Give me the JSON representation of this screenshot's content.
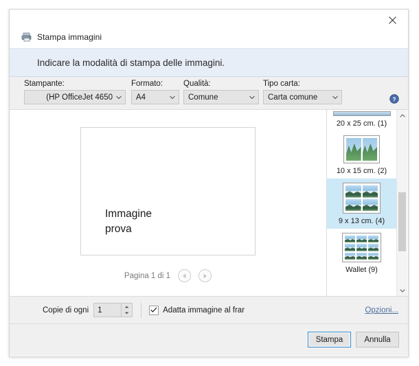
{
  "window": {
    "title": "Stampa immagini",
    "title_icon": "printer-icon",
    "close_icon": "close-icon",
    "banner_text": "Indicare la modalità di stampa delle immagini."
  },
  "options_bar": {
    "help_icon": "help-circle-icon",
    "fields": [
      {
        "key": "printer",
        "label": "Stampante:",
        "value": "(HP OfficeJet 4650",
        "align": "right"
      },
      {
        "key": "format",
        "label": "Formato:",
        "value": "A4",
        "align": "left"
      },
      {
        "key": "quality",
        "label": "Qualità:",
        "value": "Comune",
        "align": "left"
      },
      {
        "key": "papertype",
        "label": "Tipo carta:",
        "value": "Carta comune",
        "align": "left"
      }
    ]
  },
  "preview": {
    "caption_line1": "Immagine",
    "caption_line2": "prova",
    "pager_label": "Pagina 1 di 1",
    "prev_icon": "triangle-left-icon",
    "next_icon": "triangle-right-icon"
  },
  "layouts": {
    "scroll_up_icon": "chevron-up-icon",
    "scroll_down_icon": "chevron-down-icon",
    "items": [
      {
        "caption": "20 x 25 cm. (1)",
        "count": 1,
        "selected": false,
        "partial": true,
        "cols": 1,
        "rows": 1,
        "orientation": "landscape"
      },
      {
        "caption": "10 x 15 cm. (2)",
        "count": 2,
        "selected": false,
        "partial": false,
        "cols": 2,
        "rows": 1,
        "orientation": "portrait"
      },
      {
        "caption": "9 x 13 cm. (4)",
        "count": 4,
        "selected": true,
        "partial": false,
        "cols": 2,
        "rows": 2,
        "orientation": "landscape"
      },
      {
        "caption": "Wallet (9)",
        "count": 9,
        "selected": false,
        "partial": false,
        "cols": 3,
        "rows": 3,
        "orientation": "landscape"
      }
    ]
  },
  "settings": {
    "copies_label": "Copie di ogni",
    "copies_value": "1",
    "spin_up_icon": "spinner-up-icon",
    "spin_down_icon": "spinner-down-icon",
    "fit_label": "Adatta immagine al frar",
    "fit_checked": true,
    "fit_check_icon": "checkmark-icon",
    "options_link": "Opzioni..."
  },
  "footer": {
    "print_label": "Stampa",
    "cancel_label": "Annulla"
  },
  "colors": {
    "banner_bg": "#e8eef7",
    "selection": "#cde8f7",
    "accent": "#2e8ad0",
    "link": "#4a6f9e",
    "chrome_bg": "#f0f0f0"
  }
}
